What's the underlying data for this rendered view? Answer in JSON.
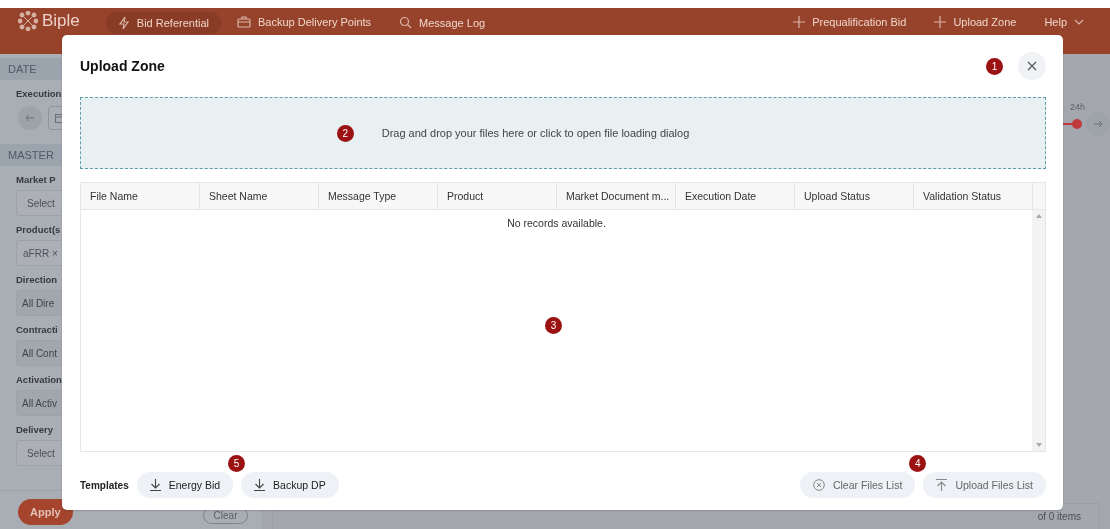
{
  "header": {
    "logo": "Biple",
    "nav": [
      {
        "label": "Bid Referential",
        "kind": "bolt",
        "selected": true
      },
      {
        "label": "Backup Delivery Points",
        "kind": "briefcase",
        "selected": false
      },
      {
        "label": "Message Log",
        "kind": "search",
        "selected": false
      }
    ],
    "actions": [
      "Prequalification Bid",
      "Upload Zone"
    ],
    "help": "Help"
  },
  "sidebar": {
    "items": [
      {
        "kind": "section",
        "text": "DATE"
      },
      {
        "kind": "label",
        "text": "Execution"
      },
      {
        "kind": "date_nav"
      },
      {
        "kind": "section",
        "text": "MASTER"
      },
      {
        "kind": "label",
        "text": "Market P"
      },
      {
        "kind": "select",
        "placeholder": "Select"
      },
      {
        "kind": "label",
        "text": "Product(s"
      },
      {
        "kind": "chips",
        "chips": [
          {
            "label": "aFRR",
            "remove": "×"
          }
        ]
      },
      {
        "kind": "label",
        "text": "Direction"
      },
      {
        "kind": "select",
        "value": "All Dire"
      },
      {
        "kind": "label",
        "text": "Contracti"
      },
      {
        "kind": "select",
        "value": "All Cont"
      },
      {
        "kind": "label",
        "text": "Activation"
      },
      {
        "kind": "select",
        "value": "All Activ"
      },
      {
        "kind": "label",
        "text": "Delivery"
      },
      {
        "kind": "select",
        "placeholder": "Select"
      }
    ],
    "apply": "Apply",
    "clear": "Clear"
  },
  "timeline": {
    "label": "24h"
  },
  "pager": {
    "text": "of 0 items"
  },
  "modal": {
    "title": "Upload Zone",
    "marker": "1",
    "dropzone": {
      "text": "Drag and drop your files here or click to open file loading dialog",
      "marker": "2"
    },
    "table": {
      "columns": [
        "File Name",
        "Sheet Name",
        "Message Type",
        "Product",
        "Market Document m...",
        "Execution Date",
        "Upload Status",
        "Validation Status"
      ],
      "empty": "No records available.",
      "marker": "3"
    },
    "templates": {
      "label": "Templates",
      "marker": "5",
      "buttons": [
        "Energy Bid",
        "Backup DP"
      ]
    },
    "actions": {
      "marker": "4",
      "buttons": [
        {
          "label": "Clear Files List",
          "kind": "clear"
        },
        {
          "label": "Upload Files List",
          "kind": "upload"
        }
      ]
    }
  }
}
